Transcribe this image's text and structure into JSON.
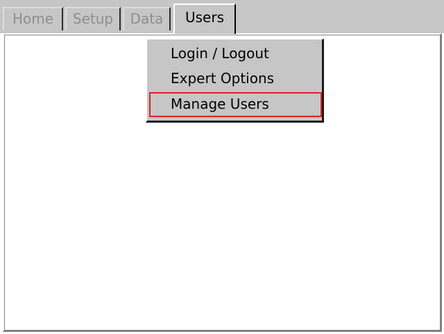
{
  "tabs": {
    "home": "Home",
    "setup": "Setup",
    "data": "Data",
    "users": "Users"
  },
  "users_menu": {
    "items": [
      "Login / Logout",
      "Expert Options",
      "Manage Users"
    ],
    "highlighted_item": "Manage Users",
    "highlight_color": "#e02020"
  },
  "colors": {
    "chrome_grey": "#c6c6c6",
    "inactive_tab_text": "#8e8e8e",
    "panel_background": "#ffffff"
  }
}
